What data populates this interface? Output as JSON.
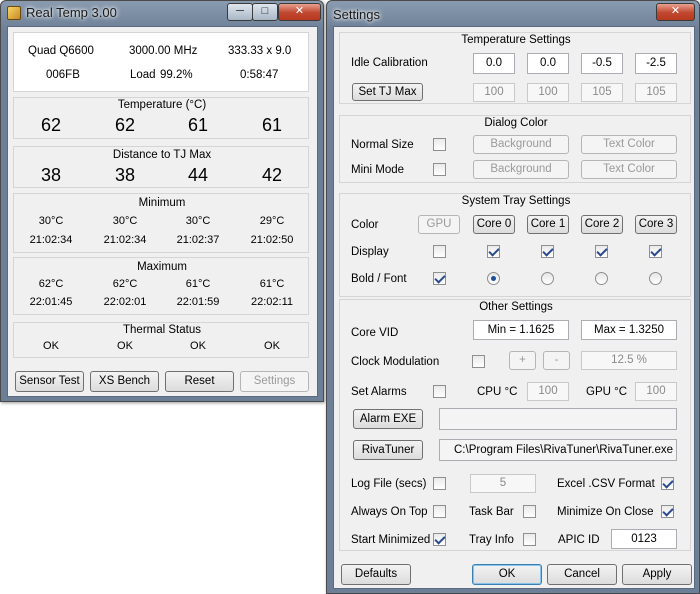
{
  "main_window": {
    "title": "Real Temp 3.00",
    "info": {
      "cpu": "Quad Q6600",
      "freq": "3000.00 MHz",
      "bus": "333.33 x 9.0",
      "id": "006FB",
      "load_label": "Load",
      "load": "99.2%",
      "time": "0:58:47"
    },
    "temperature": {
      "title": "Temperature (°C)",
      "values": [
        "62",
        "62",
        "61",
        "61"
      ]
    },
    "distance": {
      "title": "Distance to TJ Max",
      "values": [
        "38",
        "38",
        "44",
        "42"
      ]
    },
    "minimum": {
      "title": "Minimum",
      "temps": [
        "30°C",
        "30°C",
        "30°C",
        "29°C"
      ],
      "times": [
        "21:02:34",
        "21:02:34",
        "21:02:37",
        "21:02:50"
      ]
    },
    "maximum": {
      "title": "Maximum",
      "temps": [
        "62°C",
        "62°C",
        "61°C",
        "61°C"
      ],
      "times": [
        "22:01:45",
        "22:02:01",
        "22:01:59",
        "22:02:11"
      ]
    },
    "thermal": {
      "title": "Thermal Status",
      "values": [
        "OK",
        "OK",
        "OK",
        "OK"
      ]
    },
    "buttons": {
      "sensor_test": "Sensor Test",
      "xs_bench": "XS Bench",
      "reset": "Reset",
      "settings": "Settings"
    }
  },
  "settings_window": {
    "title": "Settings",
    "temperature_settings": {
      "title": "Temperature Settings",
      "idle_label": "Idle Calibration",
      "idle_values": [
        "0.0",
        "0.0",
        "-0.5",
        "-2.5"
      ],
      "set_tj_max": "Set TJ Max",
      "tj_values": [
        "100",
        "100",
        "105",
        "105"
      ]
    },
    "dialog_color": {
      "title": "Dialog Color",
      "normal_size": "Normal Size",
      "mini_mode": "Mini Mode",
      "background": "Background",
      "text_color": "Text Color"
    },
    "system_tray": {
      "title": "System Tray Settings",
      "color_label": "Color",
      "display_label": "Display",
      "bold_font_label": "Bold / Font",
      "gpu": "GPU",
      "cores": [
        "Core 0",
        "Core 1",
        "Core 2",
        "Core 3"
      ],
      "display_checked": [
        false,
        true,
        true,
        true,
        true
      ],
      "bold_checked": true,
      "font_radio_selected": 0
    },
    "other": {
      "title": "Other Settings",
      "core_vid": "Core VID",
      "vid_min": "Min = 1.1625",
      "vid_max": "Max = 1.3250",
      "clock_mod": "Clock Modulation",
      "plus": "+",
      "minus": "-",
      "clock_value": "12.5 %",
      "set_alarms": "Set Alarms",
      "cpu_c": "CPU °C",
      "cpu_alarm": "100",
      "gpu_c": "GPU °C",
      "gpu_alarm": "100",
      "alarm_exe": "Alarm EXE",
      "alarm_path": "",
      "rivatuner": "RivaTuner",
      "rivatuner_path": "C:\\Program Files\\RivaTuner\\RivaTuner.exe",
      "log_file": "Log File (secs)",
      "log_value": "5",
      "excel": "Excel .CSV Format",
      "always_on_top": "Always On Top",
      "task_bar": "Task Bar",
      "minimize_on_close": "Minimize On Close",
      "start_minimized": "Start Minimized",
      "tray_info": "Tray Info",
      "apic_id": "APIC ID",
      "apic_value": "0123"
    },
    "buttons": {
      "defaults": "Defaults",
      "ok": "OK",
      "cancel": "Cancel",
      "apply": "Apply"
    }
  }
}
